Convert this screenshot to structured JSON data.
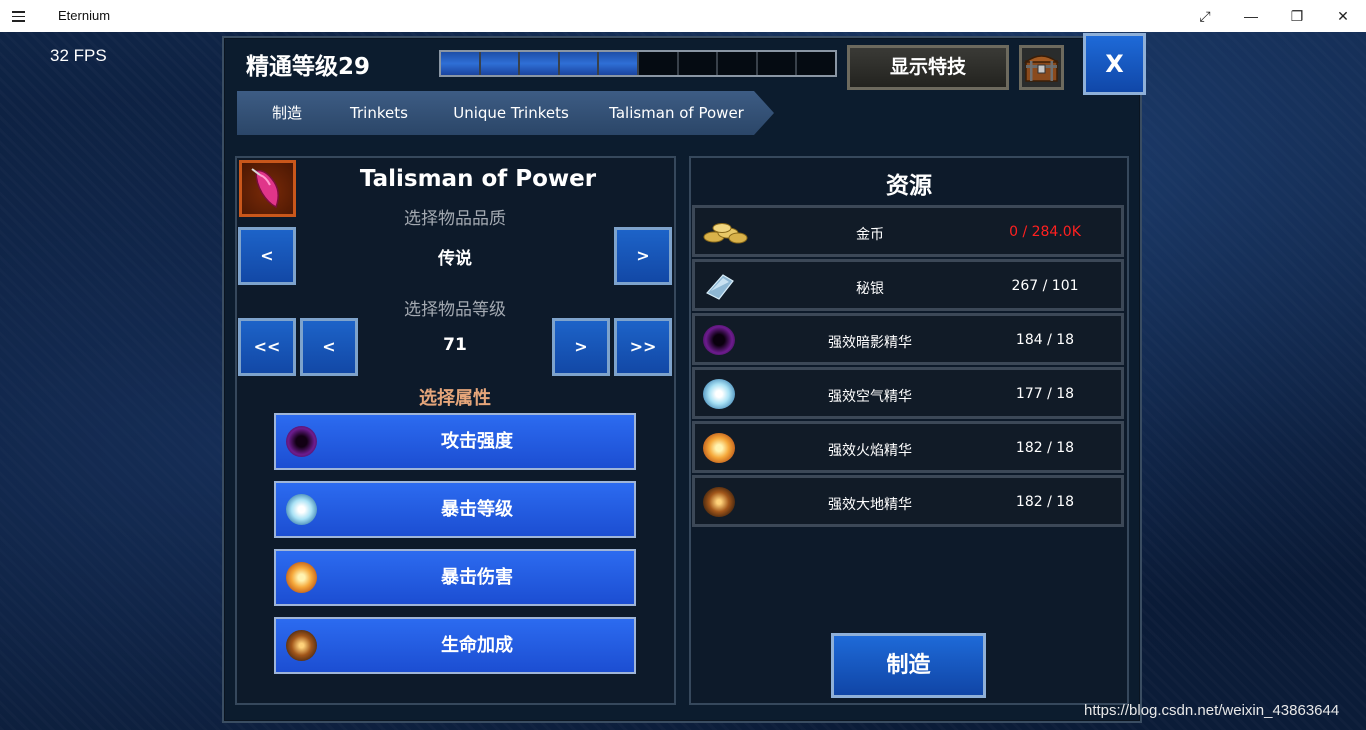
{
  "window": {
    "title": "Eternium",
    "controls": [
      "⤢",
      "—",
      "❐",
      "✕"
    ]
  },
  "fps": "32 FPS",
  "header": {
    "mastery": "精通等级29",
    "xp_segments_filled": 5,
    "xp_segments_total": 10,
    "special_button": "显示特技",
    "close_button": "X"
  },
  "breadcrumb": [
    "制造",
    "Trinkets",
    "Unique Trinkets",
    "Talisman of Power"
  ],
  "item": {
    "name": "Talisman of Power",
    "quality_label": "选择物品品质",
    "quality_value": "传说",
    "level_label": "选择物品等级",
    "level_value": "71",
    "btn_prev": "<",
    "btn_next": ">",
    "btn_first": "<<",
    "btn_last": ">>"
  },
  "attributes": {
    "label": "选择属性",
    "options": [
      {
        "label": "攻击强度",
        "orb": "shadow"
      },
      {
        "label": "暴击等级",
        "orb": "air"
      },
      {
        "label": "暴击伤害",
        "orb": "fire"
      },
      {
        "label": "生命加成",
        "orb": "earth"
      }
    ]
  },
  "resources": {
    "title": "资源",
    "items": [
      {
        "icon": "gold-coins-icon",
        "name": "金币",
        "qty": "0 / 284.0K",
        "insufficient": true
      },
      {
        "icon": "mithril-icon",
        "name": "秘银",
        "qty": "267 / 101",
        "insufficient": false
      },
      {
        "icon": "shadow-essence-icon",
        "name": "强效暗影精华",
        "qty": "184 / 18",
        "insufficient": false
      },
      {
        "icon": "air-essence-icon",
        "name": "强效空气精华",
        "qty": "177 / 18",
        "insufficient": false
      },
      {
        "icon": "fire-essence-icon",
        "name": "强效火焰精华",
        "qty": "182 / 18",
        "insufficient": false
      },
      {
        "icon": "earth-essence-icon",
        "name": "强效大地精华",
        "qty": "182 / 18",
        "insufficient": false
      }
    ]
  },
  "craft_button": "制造",
  "watermark": "https://blog.csdn.net/weixin_43863644"
}
